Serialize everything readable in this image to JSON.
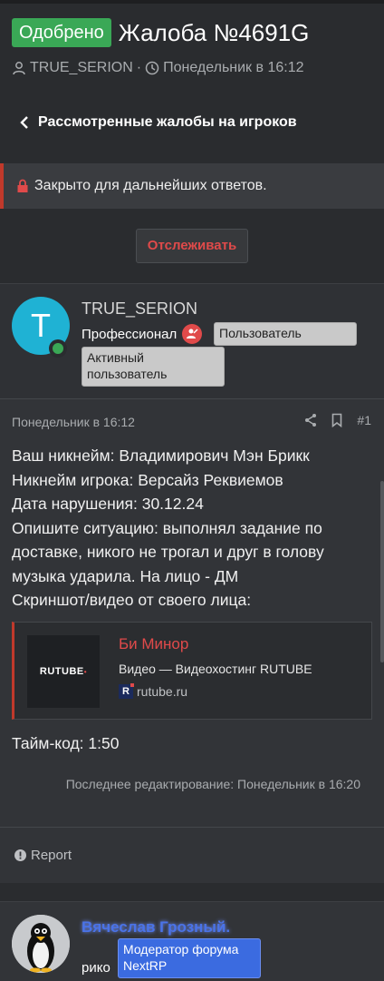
{
  "thread": {
    "status_badge": "Одобрено",
    "title": "Жалоба №4691G",
    "author": "TRUE_SERION",
    "separator": "·",
    "date": "Понедельник в 16:12",
    "back_label": "Рассмотренные жалобы на игроков",
    "closed_notice": "Закрыто для дальнейших ответов.",
    "follow_label": "Отслеживать"
  },
  "post": {
    "avatar_letter": "T",
    "author_name": "TRUE_SERION",
    "author_rank": "Профессионал",
    "tags": [
      "Пользователь",
      "Активный пользователь"
    ],
    "date": "Понедельник в 16:12",
    "number": "#1",
    "body_lines": [
      "Ваш никнейм: Владимирович Мэн Брикк",
      "Никнейм игрока: Версайз Реквиемов",
      "Дата нарушения: 30.12.24",
      "Опишите ситуацию: выполнял задание по доставке, никого не трогал и друг в голову музыка ударила. На лицо - ДМ",
      "Скриншот/видео от своего лица:"
    ],
    "embed": {
      "thumb_text": "RUTUBE",
      "title": "Би Минор",
      "description": "Видео — Видеохостинг RUTUBE",
      "site_icon_letter": "R",
      "site": "rutube.ru"
    },
    "timecode": "Тайм-код: 1:50",
    "edited": "Последнее редактирование: Понедельник в 16:20",
    "report_label": "Report"
  },
  "post2": {
    "author_name": "Вячеслав Грозный.",
    "role_partial": "рико",
    "tag": "Модератор форума NextRP"
  },
  "colors": {
    "background": "#2a2c2f",
    "approved": "#3aa856",
    "accent_red": "#e04a4a",
    "moderator_blue": "#3b6be0",
    "avatar_cyan": "#1fb2d4"
  }
}
